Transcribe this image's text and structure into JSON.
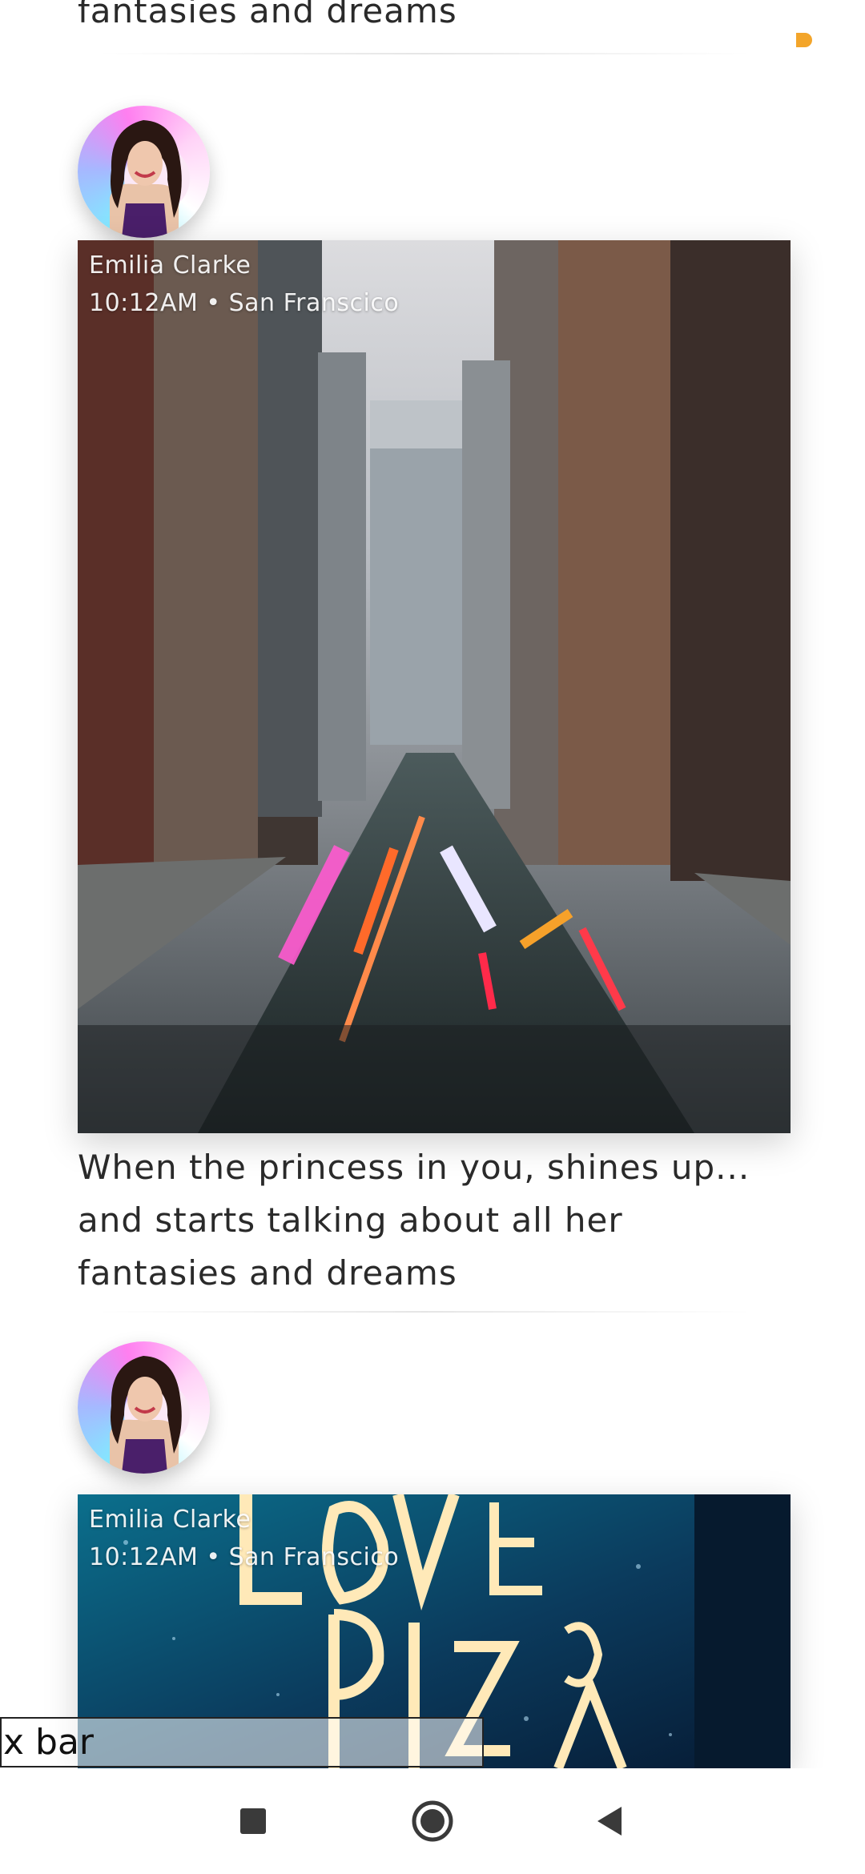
{
  "feed": {
    "top_partial_caption": "fantasies and dreams",
    "posts": [
      {
        "author": "Emilia Clarke",
        "meta": "10:12AM • San Franscico",
        "caption_lines": [
          "When the princess in you, shines up...",
          "and starts talking about all her",
          "fantasies and dreams"
        ]
      },
      {
        "author": "Emilia Clarke",
        "meta": "10:12AM • San Franscico"
      }
    ]
  },
  "debug_overlay": {
    "text": "x bar"
  },
  "colors": {
    "accent_orange": "#f3a52a"
  },
  "icons": {
    "nav_recents": "square-icon",
    "nav_home": "circle-home-icon",
    "nav_back": "triangle-back-icon"
  }
}
